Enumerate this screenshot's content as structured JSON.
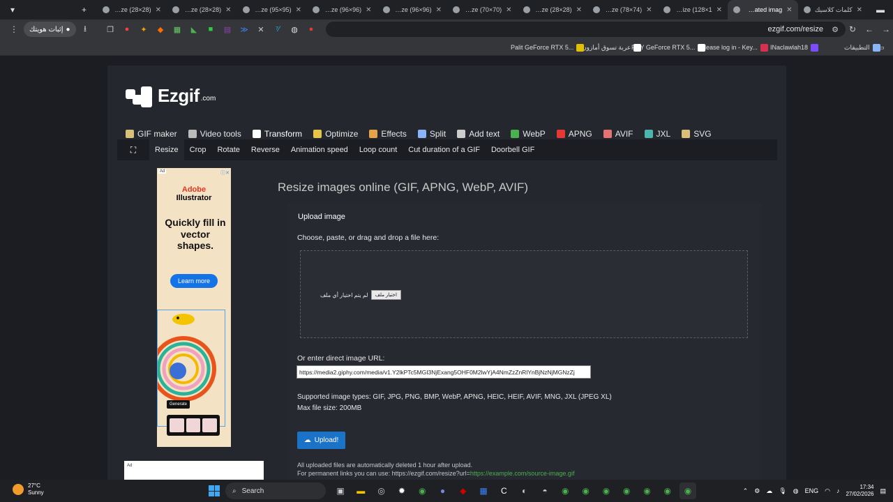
{
  "browser": {
    "tabs": [
      {
        "title": "كلمات كلاسيك",
        "active": false
      },
      {
        "title": "Animated imag",
        "active": true
      },
      {
        "title": "fullsize (128×1",
        "active": false
      },
      {
        "title": "fullsize (78×74)",
        "active": false
      },
      {
        "title": "fullsize (28×28)",
        "active": false
      },
      {
        "title": "fullsize (70×70)",
        "active": false
      },
      {
        "title": "fullsize (96×96)",
        "active": false
      },
      {
        "title": "fullsize (96×96)",
        "active": false
      },
      {
        "title": "fullsize (95×95)",
        "active": false
      },
      {
        "title": "fullsize (28×28)",
        "active": false
      },
      {
        "title": "fullsize (28×28)",
        "active": false
      }
    ],
    "new_tab_icon": "plus-icon",
    "url": "ezgif.com/resize",
    "profile_label": "إثبات هويتك",
    "bookmarks": [
      {
        "label": "التطبيقات",
        "color": "#8ab4f8"
      },
      {
        "label": "INaclawlah18",
        "color": "#7c4dff"
      },
      {
        "label": "Please log in - Key...",
        "color": "#d9304f"
      },
      {
        "label": "PNY GeForce RTX 5...",
        "color": "#ffffff"
      },
      {
        "label": "عربة تسوق أمازون",
        "color": "#ffffff"
      },
      {
        "label": "Palit GeForce RTX 5...",
        "color": "#e0c000"
      }
    ]
  },
  "site": {
    "logo_text": "Ezgif",
    "logo_suffix": ".com",
    "main_nav": [
      {
        "label": "GIF maker",
        "icon": "gif-maker-icon",
        "color": "#d9c07a"
      },
      {
        "label": "Video tools",
        "icon": "video-tools-icon",
        "color": "#bbbbbb"
      },
      {
        "label": "Transform",
        "icon": "transform-icon",
        "color": "#ffffff"
      },
      {
        "label": "Optimize",
        "icon": "optimize-icon",
        "color": "#e6c44a"
      },
      {
        "label": "Effects",
        "icon": "effects-icon",
        "color": "#e6a44a"
      },
      {
        "label": "Split",
        "icon": "split-icon",
        "color": "#8ab4f8"
      },
      {
        "label": "Add text",
        "icon": "add-text-icon",
        "color": "#cccccc"
      },
      {
        "label": "WebP",
        "icon": "webp-icon",
        "color": "#4caf50"
      },
      {
        "label": "APNG",
        "icon": "apng-icon",
        "color": "#e53935"
      },
      {
        "label": "AVIF",
        "icon": "avif-icon",
        "color": "#e57373"
      },
      {
        "label": "JXL",
        "icon": "jxl-icon",
        "color": "#4db6ac"
      },
      {
        "label": "SVG",
        "icon": "svg-icon",
        "color": "#d9c07a"
      }
    ],
    "sub_nav": [
      "Resize",
      "Crop",
      "Rotate",
      "Reverse",
      "Animation speed",
      "Loop count",
      "Cut duration of a GIF",
      "Doorbell GIF"
    ],
    "sub_nav_active": "Resize"
  },
  "ad": {
    "badge": "Ad",
    "brand_line1": "Adobe",
    "brand_line2": "Illustrator",
    "headline": "Quickly fill in vector shapes.",
    "cta": "Learn more",
    "generate_label": "Generate"
  },
  "ad2": {
    "label": "Ad"
  },
  "content": {
    "heading": "Resize images online (GIF, APNG, WebP, AVIF)",
    "upload_label": "Upload image",
    "choose_label": "Choose, paste, or drag and drop a file here:",
    "file_button": "اختيار ملف",
    "file_status": "لم يتم اختيار أي ملف",
    "url_label": "Or enter direct image URL:",
    "url_value": "https://media2.giphy.com/media/v1.Y2lkPTc5MGI3NjExang5OHF0M2lwYjA4NmZzZnRlYnBjNzNjMGNzZj",
    "types": "Supported image types: GIF, JPG, PNG, BMP, WebP, APNG, HEIC, HEIF, AVIF, MNG, JXL (JPEG XL)",
    "max_size": "Max file size: 200MB",
    "upload_button": "Upload!",
    "note1": "All uploaded files are automatically deleted 1 hour after upload.",
    "note2_prefix": "For permanent links you can use: https://ezgif.com/resize?url=",
    "note2_example": "https://example.com/source-image.gif"
  },
  "taskbar": {
    "temperature": "27°C",
    "condition": "Sunny",
    "search_label": "Search",
    "language": "ENG",
    "time": "17:34",
    "date": "27/02/2026"
  }
}
